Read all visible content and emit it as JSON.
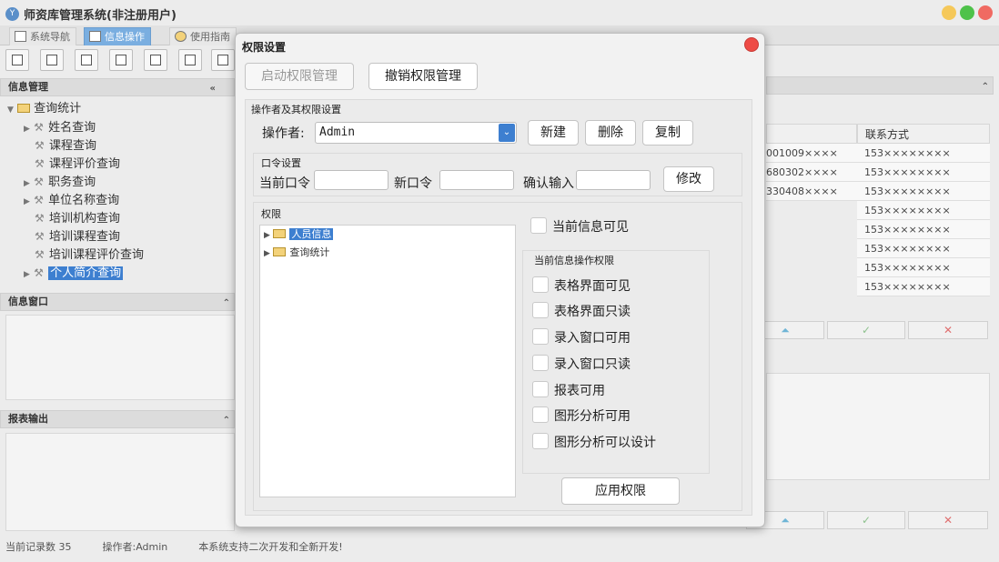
{
  "app": {
    "title": "师资库管理系统(非注册用户)",
    "logo": "Y"
  },
  "tabs": [
    {
      "label": "系统导航"
    },
    {
      "label": "信息操作"
    },
    {
      "label": "使用指南"
    }
  ],
  "left": {
    "panel1_title": "信息管理",
    "tree": [
      {
        "label": "查询统计"
      },
      {
        "label": "姓名查询"
      },
      {
        "label": "课程查询"
      },
      {
        "label": "课程评价查询"
      },
      {
        "label": "职务查询"
      },
      {
        "label": "单位名称查询"
      },
      {
        "label": "培训机构查询"
      },
      {
        "label": "培训课程查询"
      },
      {
        "label": "培训课程评价查询"
      },
      {
        "label": "个人简介查询"
      }
    ],
    "panel2_title": "信息窗口",
    "panel3_title": "报表输出"
  },
  "grid": {
    "header": "联系方式",
    "left_cells": [
      "001009×××× ",
      "680302××××",
      "330408××××"
    ],
    "right_cells": [
      "153××××××××",
      "153××××××××",
      "153××××××××",
      "153××××××××",
      "153××××××××",
      "153××××××××",
      "153××××××××",
      "153××××××××"
    ]
  },
  "status": {
    "records": "当前记录数 35",
    "operator": "操作者:Admin",
    "note": "本系统支持二次开发和全新开发!"
  },
  "dialog": {
    "title": "权限设置",
    "enable_btn": "启动权限管理",
    "revoke_btn": "撤销权限管理",
    "group1_title": "操作者及其权限设置",
    "operator_label": "操作者:",
    "operator_value": "Admin",
    "new_btn": "新建",
    "delete_btn": "删除",
    "copy_btn": "复制",
    "pwd_group": "口令设置",
    "cur_pwd": "当前口令",
    "new_pwd": "新口令",
    "confirm_pwd": "确认输入",
    "modify_btn": "修改",
    "perm_group": "权限",
    "perm_tree": [
      {
        "label": "人员信息"
      },
      {
        "label": "查询统计"
      }
    ],
    "visible_label": "当前信息可见",
    "ops_group": "当前信息操作权限",
    "ops": [
      "表格界面可见",
      "表格界面只读",
      "录入窗口可用",
      "录入窗口只读",
      "报表可用",
      "图形分析可用",
      "图形分析可以设计"
    ],
    "apply_btn": "应用权限"
  }
}
